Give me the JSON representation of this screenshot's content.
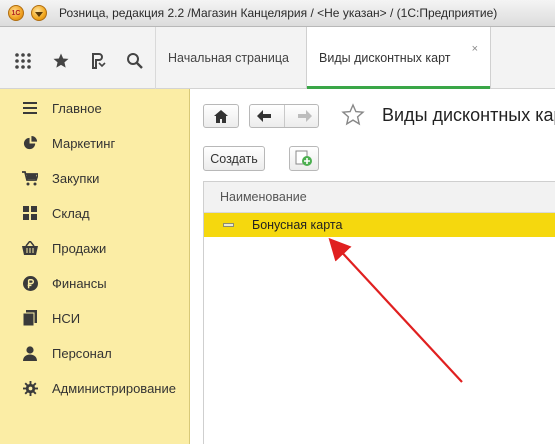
{
  "window": {
    "title": "Розница, редакция 2.2 /Магазин Канцелярия / <Не указан> /  (1С:Предприятие)",
    "logo_text": "1С"
  },
  "toolbar": {
    "icons": [
      "apps-grid-icon",
      "favorites-star-icon",
      "history-icon",
      "search-icon"
    ]
  },
  "tabs": [
    {
      "label": "Начальная страница",
      "active": false
    },
    {
      "label": "Виды дисконтных карт",
      "active": true,
      "close": "×"
    }
  ],
  "sidebar": {
    "items": [
      {
        "label": "Главное",
        "icon": "menu-lines-icon"
      },
      {
        "label": "Маркетинг",
        "icon": "pie-chart-icon"
      },
      {
        "label": "Закупки",
        "icon": "cart-icon"
      },
      {
        "label": "Склад",
        "icon": "warehouse-grid-icon"
      },
      {
        "label": "Продажи",
        "icon": "basket-icon"
      },
      {
        "label": "Финансы",
        "icon": "ruble-icon"
      },
      {
        "label": "НСИ",
        "icon": "documents-icon"
      },
      {
        "label": "Персонал",
        "icon": "person-icon"
      },
      {
        "label": "Администрирование",
        "icon": "gear-icon"
      }
    ],
    "bg_color": "#fbeda5"
  },
  "main": {
    "title": "Виды дисконтных карт",
    "create_label": "Создать",
    "table": {
      "column": "Наименование",
      "rows": [
        {
          "label": "Бонусная карта",
          "selected": true
        }
      ]
    },
    "selected_color": "#f5d80e",
    "annotation_color": "#e02020"
  }
}
